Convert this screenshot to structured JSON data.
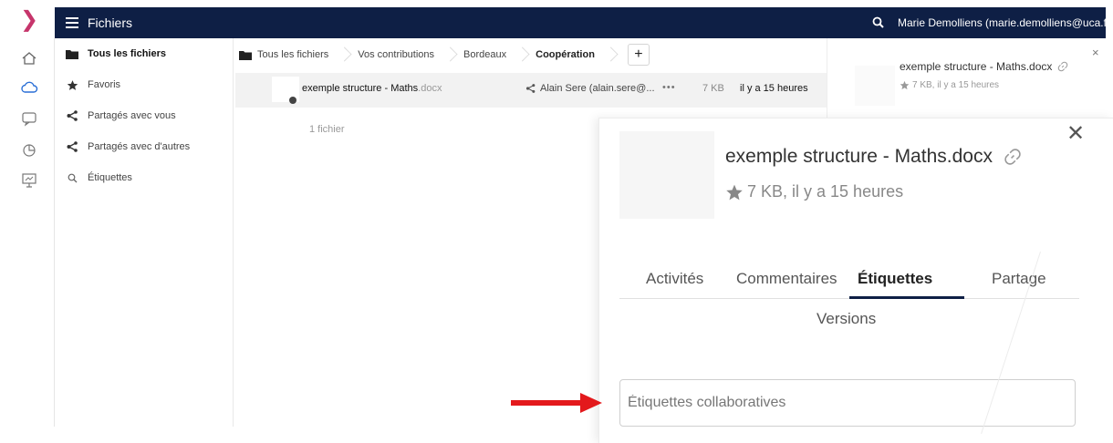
{
  "app": {
    "title": "Fichiers"
  },
  "user": {
    "label": "Marie Demolliens (marie.demolliens@uca.fr) ▾"
  },
  "rail": {
    "icons": [
      "home-icon",
      "cloud-icon",
      "chat-icon",
      "pie-chart-icon",
      "presentation-icon"
    ]
  },
  "nav": {
    "items": [
      {
        "label": "Tous les fichiers",
        "icon": "folder-icon",
        "active": true
      },
      {
        "label": "Favoris",
        "icon": "star-icon"
      },
      {
        "label": "Partagés avec vous",
        "icon": "share-icon"
      },
      {
        "label": "Partagés avec d'autres",
        "icon": "share-icon"
      },
      {
        "label": "Étiquettes",
        "icon": "search-icon"
      }
    ]
  },
  "breadcrumb": {
    "items": [
      "Tous les fichiers",
      "Vos contributions",
      "Bordeaux",
      "Coopération"
    ],
    "add_label": "+"
  },
  "file": {
    "name": "exemple structure - Maths",
    "ext": ".docx",
    "shared_with": "Alain Sere (alain.sere@...",
    "more": "•••",
    "size": "7 KB",
    "modified": "il y a 15 heures"
  },
  "list": {
    "count": "1 fichier"
  },
  "side_panel": {
    "title": "exemple structure - Maths.docx",
    "meta": "7 KB, il y a 15 heures",
    "close": "×"
  },
  "details": {
    "title": "exemple structure - Maths.docx",
    "meta": "7 KB, il y a 15 heures",
    "close": "✕",
    "tabs": [
      "Activités",
      "Commentaires",
      "Étiquettes",
      "Partage"
    ],
    "active_tab": "Étiquettes",
    "tab_row2": "Versions",
    "tags_placeholder": "Étiquettes collaboratives"
  },
  "colors": {
    "topbar": "#0e1f45",
    "brand": "#c6356b",
    "arrow": "#e3191c"
  }
}
